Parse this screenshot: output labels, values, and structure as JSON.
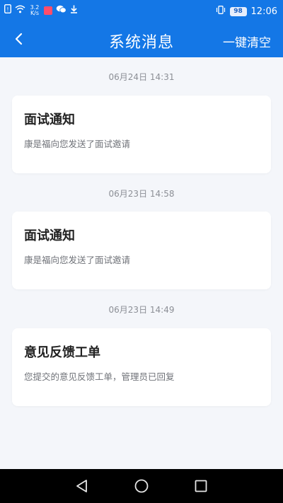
{
  "status_bar": {
    "net_speed_value": "3.2",
    "net_speed_unit": "K/s",
    "battery": "98",
    "time": "12:06",
    "icons": [
      "sim-icon",
      "wifi-icon",
      "app-notification-icon",
      "wechat-icon",
      "download-icon",
      "vibrate-icon"
    ]
  },
  "header": {
    "title": "系统消息",
    "clear_label": "一键清空",
    "back_icon": "chevron-left-icon",
    "background_color": "#1477e6"
  },
  "messages": [
    {
      "date": "06月24日 14:31",
      "title": "面试通知",
      "desc": "康是福向您发送了面试邀请"
    },
    {
      "date": "06月23日 14:58",
      "title": "面试通知",
      "desc": "康是福向您发送了面试邀请"
    },
    {
      "date": "06月23日 14:49",
      "title": "意见反馈工单",
      "desc": "您提交的意见反馈工单，管理员已回复"
    }
  ],
  "system_nav": {
    "icons": [
      "back-triangle-icon",
      "home-circle-icon",
      "recents-square-icon"
    ]
  }
}
